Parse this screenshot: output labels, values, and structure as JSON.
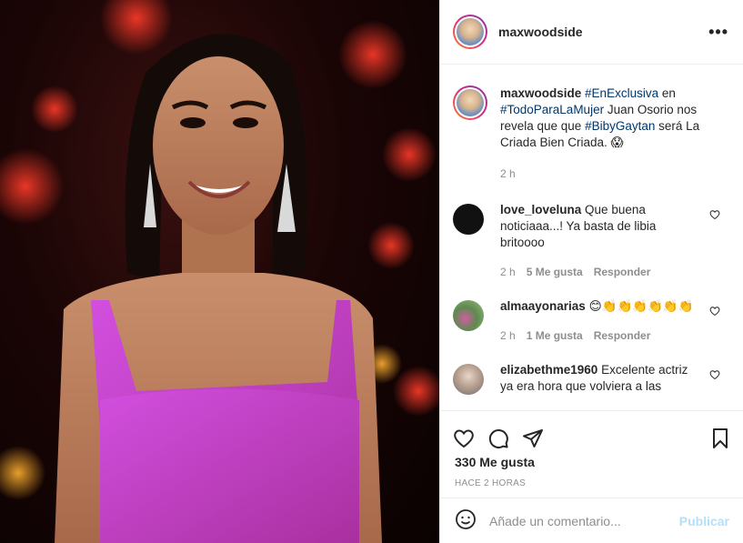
{
  "post": {
    "username": "maxwoodside",
    "more_label": "•••"
  },
  "caption": {
    "username": "maxwoodside",
    "tag1": "#EnExclusiva",
    "text1": " en ",
    "tag2": "#TodoParaLaMujer",
    "text2": " Juan Osorio nos revela que que ",
    "tag3": "#BibyGaytan",
    "text3": " será La Criada Bien Criada. 😱",
    "time": "2 h"
  },
  "comments": [
    {
      "username": "love_loveluna",
      "text": " Que buena noticiaaa...! Ya basta de libia britoooo",
      "time": "2 h",
      "likes": "5 Me gusta",
      "reply": "Responder"
    },
    {
      "username": "almaayonarias",
      "text": " 😊👏👏👏👏👏👏",
      "time": "2 h",
      "likes": "1 Me gusta",
      "reply": "Responder"
    },
    {
      "username": "elizabethme1960",
      "text": " Excelente actriz ya era hora que volviera a las",
      "time": "",
      "likes": "",
      "reply": ""
    }
  ],
  "footer": {
    "likes": "330 Me gusta",
    "ago": "HACE 2 HORAS",
    "comment_placeholder": "Añade un comentario...",
    "publish": "Publicar"
  },
  "icons": {
    "like": "heart-icon",
    "comment": "comment-icon",
    "share": "share-icon",
    "save": "bookmark-icon",
    "emoji": "emoji-icon"
  },
  "colors": {
    "link": "#00376b",
    "muted": "#8e8e8e",
    "publish": "#b2dffc",
    "dress": "#c23fd0"
  }
}
